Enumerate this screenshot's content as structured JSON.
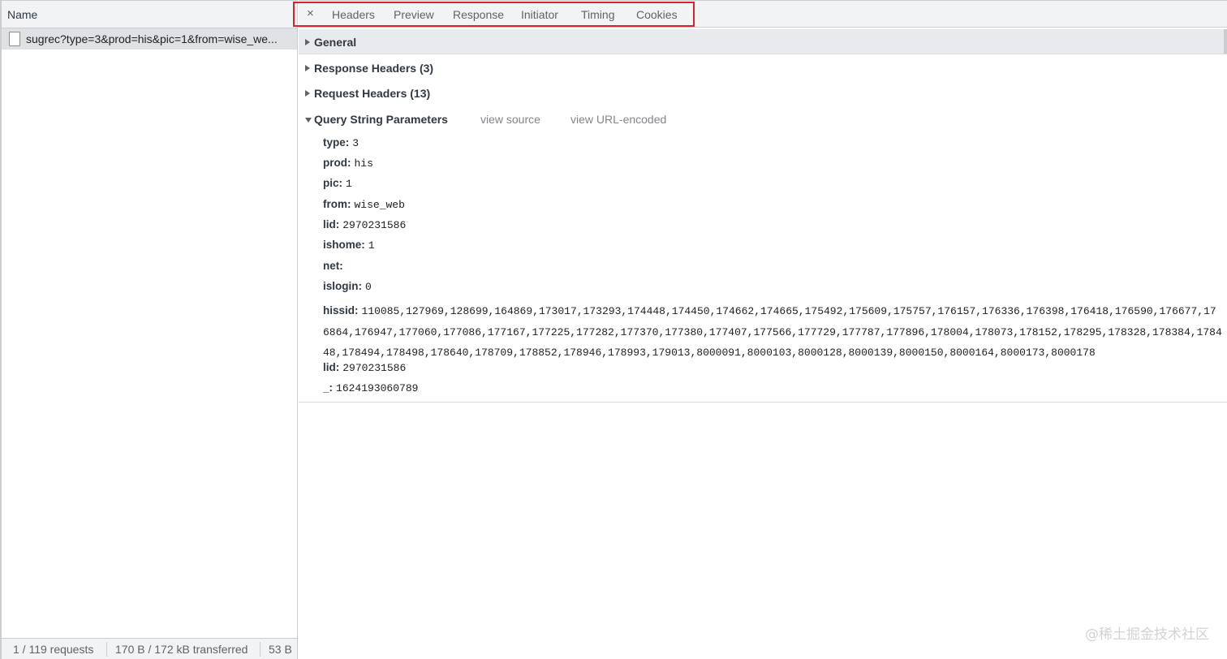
{
  "left": {
    "header": "Name",
    "request_name": "sugrec?type=3&prod=his&pic=1&from=wise_we...",
    "status": {
      "requests": "1 / 119 requests",
      "transferred": "170 B / 172 kB transferred",
      "resources": "53 B"
    }
  },
  "tabs": {
    "close": "×",
    "items": [
      "Headers",
      "Preview",
      "Response",
      "Initiator",
      "Timing",
      "Cookies"
    ]
  },
  "sections": {
    "general": "General",
    "response_headers": "Response Headers (3)",
    "request_headers": "Request Headers (13)",
    "query_params": "Query String Parameters",
    "view_source": "view source",
    "view_url_encoded": "view URL-encoded"
  },
  "params": [
    {
      "key": "type:",
      "value": "3"
    },
    {
      "key": "prod:",
      "value": "his"
    },
    {
      "key": "pic:",
      "value": "1"
    },
    {
      "key": "from:",
      "value": "wise_web"
    },
    {
      "key": "lid:",
      "value": "2970231586"
    },
    {
      "key": "ishome:",
      "value": "1"
    },
    {
      "key": "net:",
      "value": ""
    },
    {
      "key": "islogin:",
      "value": "0"
    }
  ],
  "hissid": {
    "key": "hissid:",
    "value": "110085,127969,128699,164869,173017,173293,174448,174450,174662,174665,175492,175609,175757,176157,176336,176398,176418,176590,176677,176864,176947,177060,177086,177167,177225,177282,177370,177380,177407,177566,177729,177787,177896,178004,178073,178152,178295,178328,178384,178448,178494,178498,178640,178709,178852,178946,178993,179013,8000091,8000103,8000128,8000139,8000150,8000164,8000173,8000178"
  },
  "params_after": [
    {
      "key": "lid:",
      "value": "2970231586"
    },
    {
      "key": "_:",
      "value": "1624193060789"
    }
  ],
  "watermark": "@稀土掘金技术社区",
  "colors": {
    "highlight_box": "#d9222a",
    "section_bar": "#e8eaed",
    "selected_row": "#dfe1e5"
  }
}
